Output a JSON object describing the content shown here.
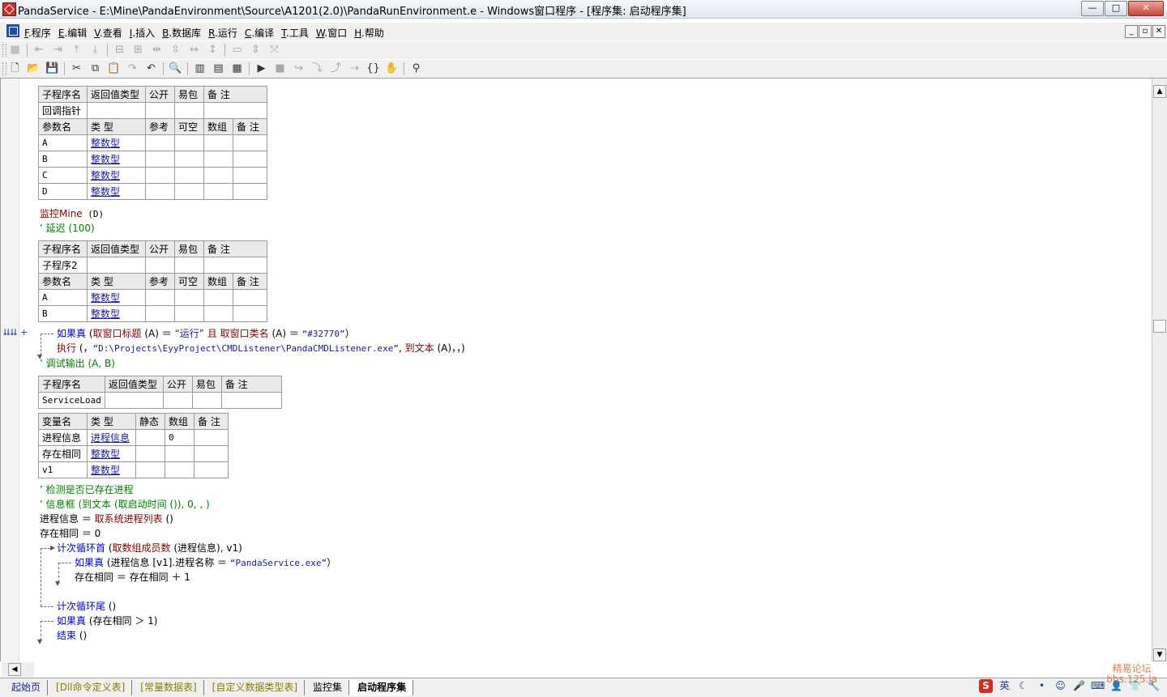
{
  "window": {
    "title": "PandaService - E:\\Mine\\PandaEnvironment\\Source\\A1201(2.0)\\PandaRunEnvironment.e - Windows窗口程序 - [程序集: 启动程序集]",
    "buttons": {
      "minimize": "—",
      "maximize": "□",
      "close": "✕"
    }
  },
  "menubar": {
    "items": [
      {
        "key": "F",
        "rest": ".程序"
      },
      {
        "key": "E",
        "rest": ".编辑"
      },
      {
        "key": "V",
        "rest": ".查看"
      },
      {
        "key": "I",
        "rest": ".插入"
      },
      {
        "key": "B",
        "rest": ".数据库"
      },
      {
        "key": "R",
        "rest": ".运行"
      },
      {
        "key": "C",
        "rest": ".编译"
      },
      {
        "key": "T",
        "rest": ".工具"
      },
      {
        "key": "W",
        "rest": ".窗口"
      },
      {
        "key": "H",
        "rest": ".帮助"
      }
    ],
    "mdi": {
      "minimize": "_",
      "restore": "▫",
      "close": "✕"
    }
  },
  "sub1": {
    "header": [
      "子程序名",
      "返回值类型",
      "公开",
      "易包",
      "备 注"
    ],
    "row": [
      "回调指针",
      "",
      "",
      "",
      ""
    ],
    "param_header": [
      "参数名",
      "类 型",
      "参考",
      "可空",
      "数组",
      "备 注"
    ],
    "params": [
      {
        "name": "A",
        "type": "整数型"
      },
      {
        "name": "B",
        "type": "整数型"
      },
      {
        "name": "C",
        "type": "整数型"
      },
      {
        "name": "D",
        "type": "整数型"
      }
    ]
  },
  "code1": {
    "line1_cmd": "监控Mine",
    "line1_args": " (D)",
    "line2": "’ 延迟 (100)"
  },
  "sub2": {
    "header": [
      "子程序名",
      "返回值类型",
      "公开",
      "易包",
      "备 注"
    ],
    "row": [
      "子程序2",
      "",
      "",
      "",
      ""
    ],
    "param_header": [
      "参数名",
      "类 型",
      "参考",
      "可空",
      "数组",
      "备 注"
    ],
    "params": [
      {
        "name": "A",
        "type": "整数型"
      },
      {
        "name": "B",
        "type": "整数型"
      }
    ]
  },
  "gutter": {
    "marker": "⮇⮇ +"
  },
  "code2": {
    "if_kw": "如果真",
    "if_a": " (",
    "if_b": "取窗口标题",
    "if_c": " (A) ＝ ",
    "if_d": "“运行”",
    "if_e": " 且 ",
    "if_f": "取窗口类名",
    "if_g": " (A) ＝ ",
    "if_h": "“#32770”",
    "if_i": "）",
    "exec_a": "执行",
    "exec_b": " (，",
    "exec_c": "“D:\\Projects\\EyyProject\\CMDListener\\PandaCMDListener.exe”",
    "exec_d": ", ",
    "exec_e": "到文本",
    "exec_f": " (A)，，)",
    "debug": "’ 调试输出 (A, B)"
  },
  "sub3": {
    "header": [
      "子程序名",
      "返回值类型",
      "公开",
      "易包",
      "备 注"
    ],
    "row": [
      "ServiceLoad",
      "",
      "",
      "",
      ""
    ]
  },
  "vars": {
    "header": [
      "变量名",
      "类 型",
      "静态",
      "数组",
      "备 注"
    ],
    "rows": [
      {
        "name": "进程信息",
        "type": "进程信息",
        "static": "",
        "array": "0"
      },
      {
        "name": "存在相同",
        "type": "整数型",
        "static": "",
        "array": ""
      },
      {
        "name": "v1",
        "type": "整数型",
        "static": "",
        "array": ""
      }
    ]
  },
  "code3": {
    "c1": "’ 检测是否已存在进程",
    "c2": "’ 信息框 (到文本 (取启动时间 ()), 0, , )",
    "l3a": "进程信息 ＝ ",
    "l3b": "取系统进程列表",
    "l3c": " ()",
    "l4": "存在相同 ＝ 0",
    "loop_kw": "计次循环首",
    "loop_a": " (",
    "loop_b": "取数组成员数",
    "loop_c": " (进程信息), v1)",
    "if2_kw": "如果真",
    "if2_a": " (进程信息 [v1].进程名称 ＝ ",
    "if2_b": "“PandaService.exe”",
    "if2_c": "）",
    "inc": "存在相同 ＝ 存在相同 ＋ 1",
    "loop_end_kw": "计次循环尾",
    "loop_end_a": " ()",
    "if3_kw": "如果真",
    "if3_a": " (存在相同 ＞ 1)",
    "end_kw": "结束",
    "end_a": " ()"
  },
  "tabs": [
    {
      "label": "起始页",
      "style": "link"
    },
    {
      "label": "[Dll命令定义表]",
      "style": "dim"
    },
    {
      "label": "[常量数据表]",
      "style": "dim"
    },
    {
      "label": "[自定义数据类型表]",
      "style": "dim"
    },
    {
      "label": "监控集",
      "style": "normal"
    },
    {
      "label": "启动程序集",
      "style": "active"
    }
  ],
  "tray": {
    "ime_label": "英",
    "watermark_line1": "精易论坛",
    "watermark_line2": "bbs.125.la"
  }
}
